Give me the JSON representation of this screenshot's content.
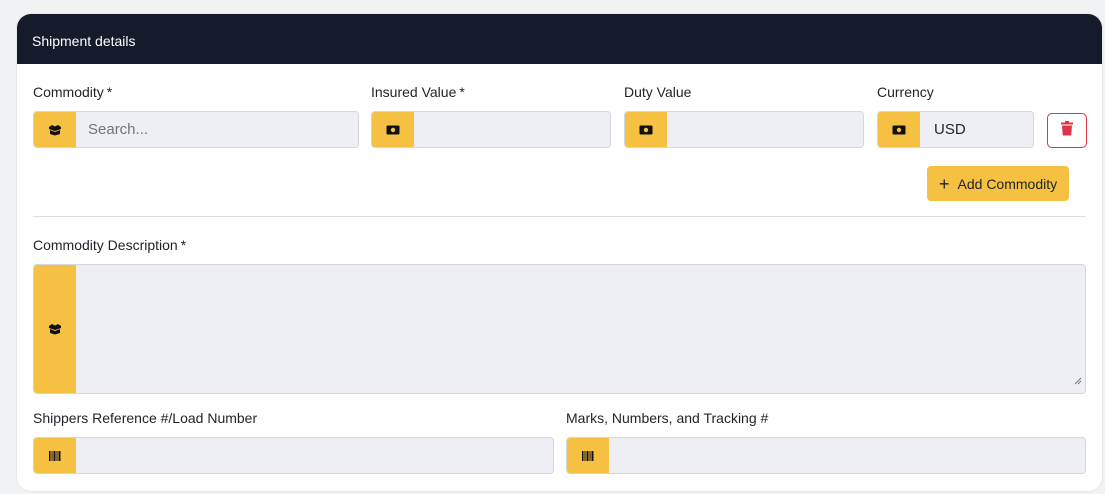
{
  "card": {
    "title": "Shipment details"
  },
  "commodity_row": {
    "commodity": {
      "label": "Commodity",
      "required_mark": "*",
      "placeholder": "Search...",
      "value": "",
      "icon": "box-icon"
    },
    "insured_value": {
      "label": "Insured Value",
      "required_mark": "*",
      "value": "",
      "icon": "money-icon"
    },
    "duty_value": {
      "label": "Duty Value",
      "value": "",
      "icon": "money-icon"
    },
    "currency": {
      "label": "Currency",
      "value": "USD",
      "icon": "money-icon"
    },
    "delete_icon": "trash-icon",
    "add_button": {
      "icon": "plus",
      "label": "Add Commodity"
    }
  },
  "description": {
    "label": "Commodity Description",
    "required_mark": "*",
    "value": "",
    "icon": "box-icon"
  },
  "references": {
    "shippers_reference": {
      "label": "Shippers Reference #/Load Number",
      "value": "",
      "icon": "barcode-icon"
    },
    "marks_numbers": {
      "label": "Marks, Numbers, and Tracking #",
      "value": "",
      "icon": "barcode-icon"
    }
  },
  "colors": {
    "header_bg": "#161b2b",
    "accent": "#f6c143",
    "input_bg": "#edeff4",
    "danger": "#dc3545"
  }
}
